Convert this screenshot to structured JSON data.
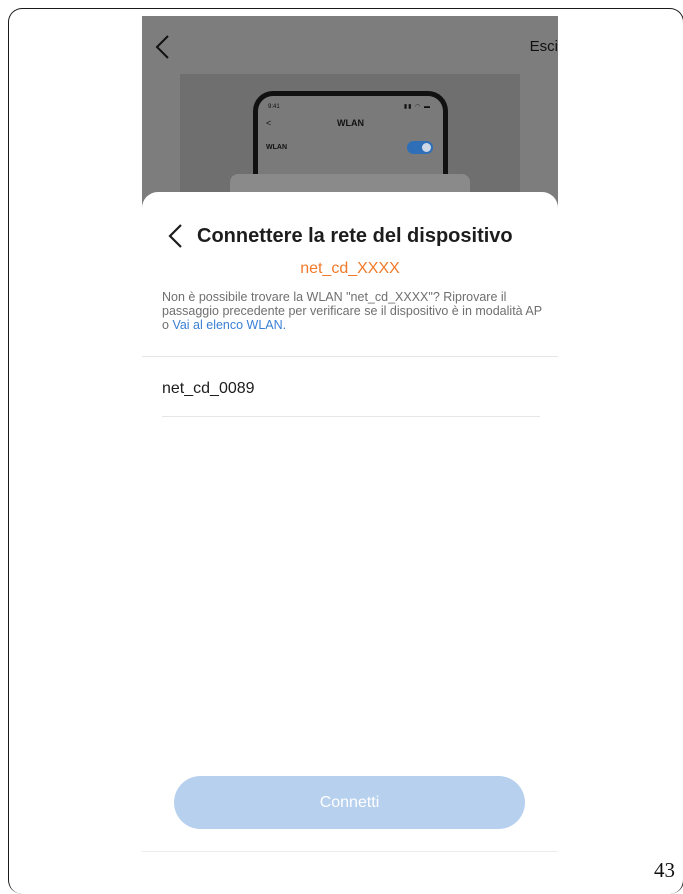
{
  "background_screen": {
    "exit_label": "Esci",
    "mock_phone": {
      "time": "9:41",
      "title": "WLAN",
      "back": "<",
      "wlan_row_label": "WLAN"
    }
  },
  "sheet": {
    "title": "Connettere la rete del dispositivo",
    "ssid_pattern": "net_cd_XXXX",
    "help_text": "Non è possibile trovare la WLAN \"net_cd_XXXX\"? Riprovare il passaggio precedente per verificare se il dispositivo è in modalità AP o ",
    "help_link": "Vai al elenco WLAN.",
    "networks": [
      {
        "name": "net_cd_0089"
      }
    ],
    "connect_button": "Connetti"
  },
  "page_number": "43",
  "colors": {
    "accent_orange": "#f07a2a",
    "link_blue": "#3a7fd5",
    "button_disabled": "#b6d0ee"
  }
}
